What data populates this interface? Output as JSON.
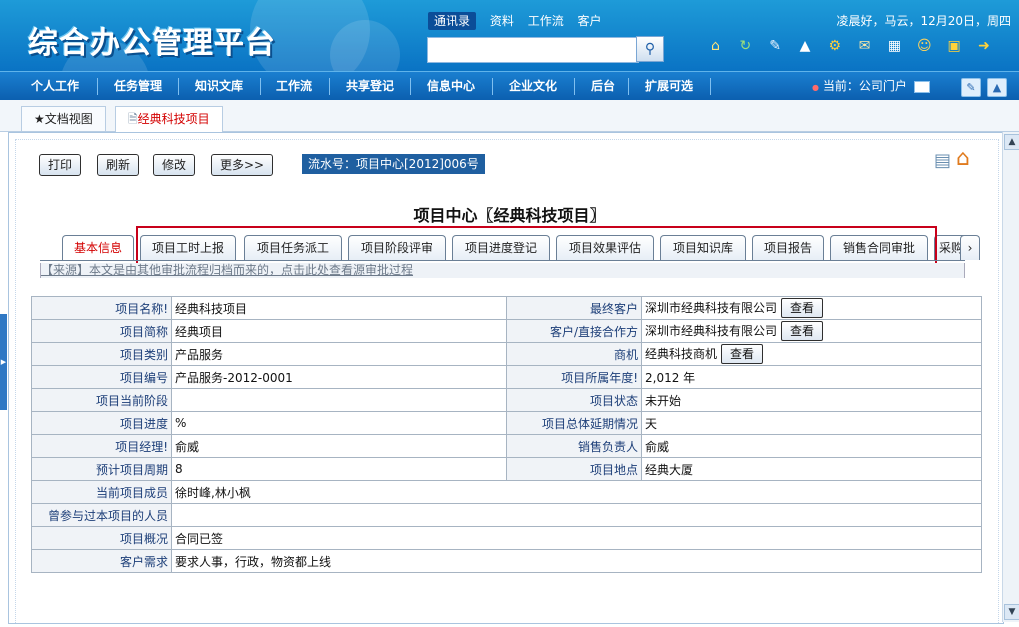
{
  "header": {
    "logo_text": "综合办公管理平台",
    "search_links": [
      "通讯录",
      "资料",
      "工作流",
      "客户"
    ],
    "search_placeholder": "",
    "search_icon": "magnifier-icon",
    "greeting": "凌晨好，马云，12月20日，周四",
    "top_icons": [
      "home-icon",
      "refresh-icon",
      "edit-icon",
      "shirt-icon",
      "settings-icon",
      "mail-icon",
      "calendar-icon",
      "user-icon",
      "note-icon",
      "exit-icon"
    ]
  },
  "nav": {
    "items": [
      "个人工作",
      "任务管理",
      "知识文库",
      "工作流",
      "共享登记",
      "信息中心",
      "企业文化",
      "后台",
      "扩展可选"
    ],
    "current_portal": "当前：公司门户"
  },
  "doc_tabs": [
    "★文档视图",
    "经典科技项目"
  ],
  "toolbar": {
    "buttons": [
      "打印",
      "刷新",
      "修改",
      "更多>>"
    ],
    "serial": "流水号：项目中心[2012]006号"
  },
  "page_title": "项目中心〖经典科技项目〗",
  "tabs": [
    "基本信息",
    "项目工时上报",
    "项目任务派工",
    "项目阶段评审",
    "项目进度登记",
    "项目效果评估",
    "项目知识库",
    "项目报告",
    "销售合同审批",
    "采购"
  ],
  "source_text": "【来源】本文是由其他审批流程归档而来的，点击此处查看源审批过程",
  "view_button": "查看",
  "rows": [
    {
      "l1": "项目名称!",
      "v1": "经典科技项目",
      "l2": "最终客户",
      "v2": "深圳市经典科技有限公司",
      "btn": true
    },
    {
      "l1": "项目简称",
      "v1": "经典项目",
      "l2": "客户/直接合作方",
      "v2": "深圳市经典科技有限公司",
      "btn": true
    },
    {
      "l1": "项目类别",
      "v1": "产品服务",
      "l2": "商机",
      "v2": "经典科技商机",
      "btn": true
    },
    {
      "l1": "项目编号",
      "v1": "产品服务-2012-0001",
      "l2": "项目所属年度!",
      "v2": "2,012 年",
      "btn": false
    },
    {
      "l1": "项目当前阶段",
      "v1": "",
      "l2": "项目状态",
      "v2": "未开始",
      "btn": false
    },
    {
      "l1": "项目进度",
      "v1": "%",
      "l2": "项目总体延期情况",
      "v2": "天",
      "btn": false
    },
    {
      "l1": "项目经理!",
      "v1": "俞威",
      "l2": "销售负责人",
      "v2": "俞威",
      "btn": false
    },
    {
      "l1": "预计项目周期",
      "v1": "8",
      "l2": "项目地点",
      "v2": "经典大厦",
      "btn": false
    }
  ],
  "wide_rows": [
    {
      "l": "当前项目成员",
      "v": "徐时峰,林小枫"
    },
    {
      "l": "曾参与过本项目的人员",
      "v": ""
    },
    {
      "l": "项目概况",
      "v": "合同已签"
    },
    {
      "l": "客户需求",
      "v": "要求人事，行政，物资都上线"
    }
  ]
}
